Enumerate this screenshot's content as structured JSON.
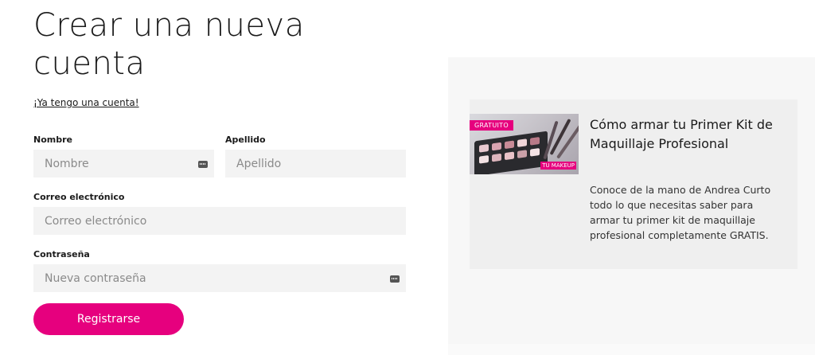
{
  "form": {
    "title": "Crear una nueva cuenta",
    "login_link": "¡Ya tengo una cuenta!",
    "first_name": {
      "label": "Nombre",
      "placeholder": "Nombre"
    },
    "last_name": {
      "label": "Apellido",
      "placeholder": "Apellido"
    },
    "email": {
      "label": "Correo electrónico",
      "placeholder": "Correo electrónico"
    },
    "password": {
      "label": "Contraseña",
      "placeholder": "Nueva contraseña"
    },
    "submit_label": "Registrarse"
  },
  "promo": {
    "badge": "GRATUITO",
    "thumb_tag": "TU MAKEUP",
    "title": "Cómo armar tu Primer Kit de Maquillaje Profesional",
    "description": "Conoce de la mano de Andrea Curto todo lo que necesitas saber para armar tu primer kit de maquillaje profesional completamente GRATIS."
  },
  "colors": {
    "accent": "#e6007e",
    "input_bg": "#f3f3f3",
    "panel_bg": "#f7f7f7",
    "card_bg": "#efefef"
  }
}
